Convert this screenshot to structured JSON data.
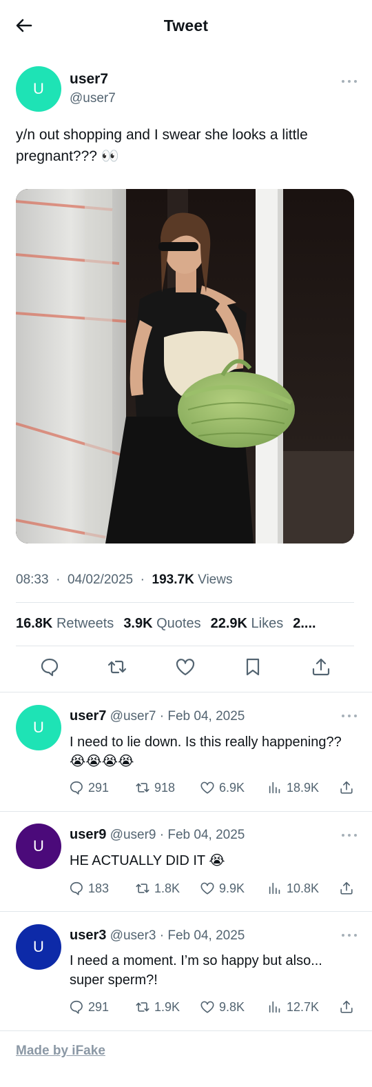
{
  "header": {
    "title": "Tweet",
    "back_icon": "arrow-left-icon"
  },
  "main_tweet": {
    "avatar_letter": "U",
    "avatar_color": "#1ee3b5",
    "name": "user7",
    "handle": "@user7",
    "text": "y/n out shopping and I swear she looks a little pregnant??? 👀",
    "time": "08:33",
    "date": "04/02/2025",
    "views_count": "193.7K",
    "views_label": "Views",
    "retweets_count": "16.8K",
    "retweets_label": "Retweets",
    "quotes_count": "3.9K",
    "quotes_label": "Quotes",
    "likes_count": "22.9K",
    "likes_label": "Likes",
    "bookmarks_truncated": "2...."
  },
  "replies": [
    {
      "avatar_letter": "U",
      "avatar_color": "#1ee3b5",
      "name": "user7",
      "handle": "@user7",
      "date": "Feb 04, 2025",
      "text": "I need to lie down. Is this really happening?? 😭😭😭😭",
      "replies": "291",
      "retweets": "918",
      "likes": "6.9K",
      "views": "18.9K"
    },
    {
      "avatar_letter": "U",
      "avatar_color": "#4b0a7a",
      "name": "user9",
      "handle": "@user9",
      "date": "Feb 04, 2025",
      "text": "HE ACTUALLY DID IT 😭",
      "replies": "183",
      "retweets": "1.8K",
      "likes": "9.9K",
      "views": "10.8K"
    },
    {
      "avatar_letter": "U",
      "avatar_color": "#0d2aa8",
      "name": "user3",
      "handle": "@user3",
      "date": "Feb 04, 2025",
      "text": "I need a moment. I’m so happy but also... super sperm?!",
      "replies": "291",
      "retweets": "1.9K",
      "likes": "9.8K",
      "views": "12.7K"
    }
  ],
  "footer": {
    "made_by": "Made by iFake"
  }
}
